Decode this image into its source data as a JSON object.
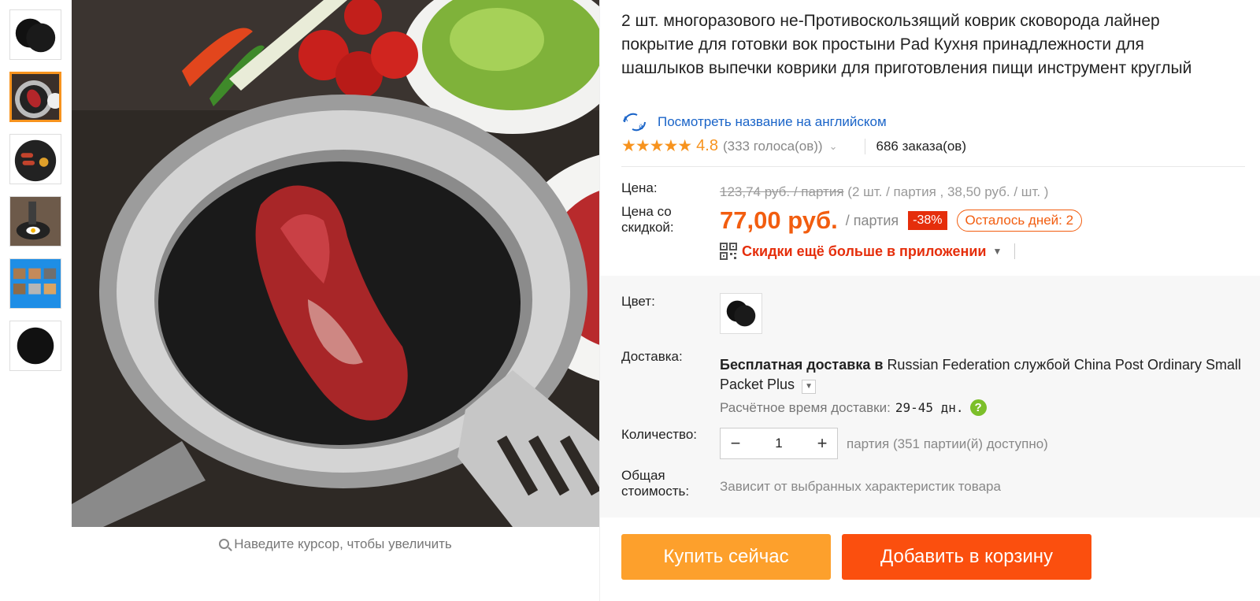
{
  "gallery": {
    "thumbnails": [
      "mat-pair",
      "steak-pan",
      "sausages-pan",
      "egg-pan",
      "collage",
      "single-mat"
    ],
    "active_index": 1,
    "zoom_hint": "Наведите курсор, чтобы увеличить"
  },
  "product": {
    "title": "2 шт. многоразового не-Противоскользящий коврик сковорода лайнер покрытие для готовки вок простыни Pad Кухня принадлежности для шашлыков выпечки коврики для приготовления пищи инструмент круглый",
    "translate_link": "Посмотреть название на английском",
    "stars": "★★★★★",
    "rating": "4.8",
    "votes": "(333 голоса(ов))",
    "orders": "686 заказа(ов)"
  },
  "price": {
    "label": "Цена:",
    "old": "123,74 руб. / партия",
    "old_detail": "(2 шт. / партия , 38,50 руб. / шт. )",
    "discount_label": "Цена со скидкой:",
    "new": "77,00 руб.",
    "unit": "/ партия",
    "discount": "-38%",
    "days_left": "Осталось дней: 2",
    "app_promo": "Скидки ещё больше в приложении"
  },
  "options": {
    "color_label": "Цвет:",
    "shipping_label": "Доставка:",
    "shipping_free": "Бесплатная доставка в",
    "shipping_dest": "Russian Federation",
    "shipping_via": "службой",
    "shipping_service": "China Post Ordinary Small Packet Plus",
    "eta_label": "Расчётное время доставки:",
    "eta_value": "29-45 дн.",
    "qty_label": "Количество:",
    "qty_minus": "−",
    "qty_value": "1",
    "qty_plus": "+",
    "qty_avail": "партия (351 партии(й) доступно)",
    "total_label": "Общая стоимость:",
    "total_value": "Зависит от выбранных характеристик товара"
  },
  "actions": {
    "buy_now": "Купить сейчас",
    "add_to_cart": "Добавить в корзину"
  },
  "colors": {
    "accent_orange": "#f7931e",
    "price_red": "#f25d0f",
    "buy_bg": "#fda02c",
    "cart_bg": "#fb4f0e",
    "link_blue": "#1a64c8"
  }
}
